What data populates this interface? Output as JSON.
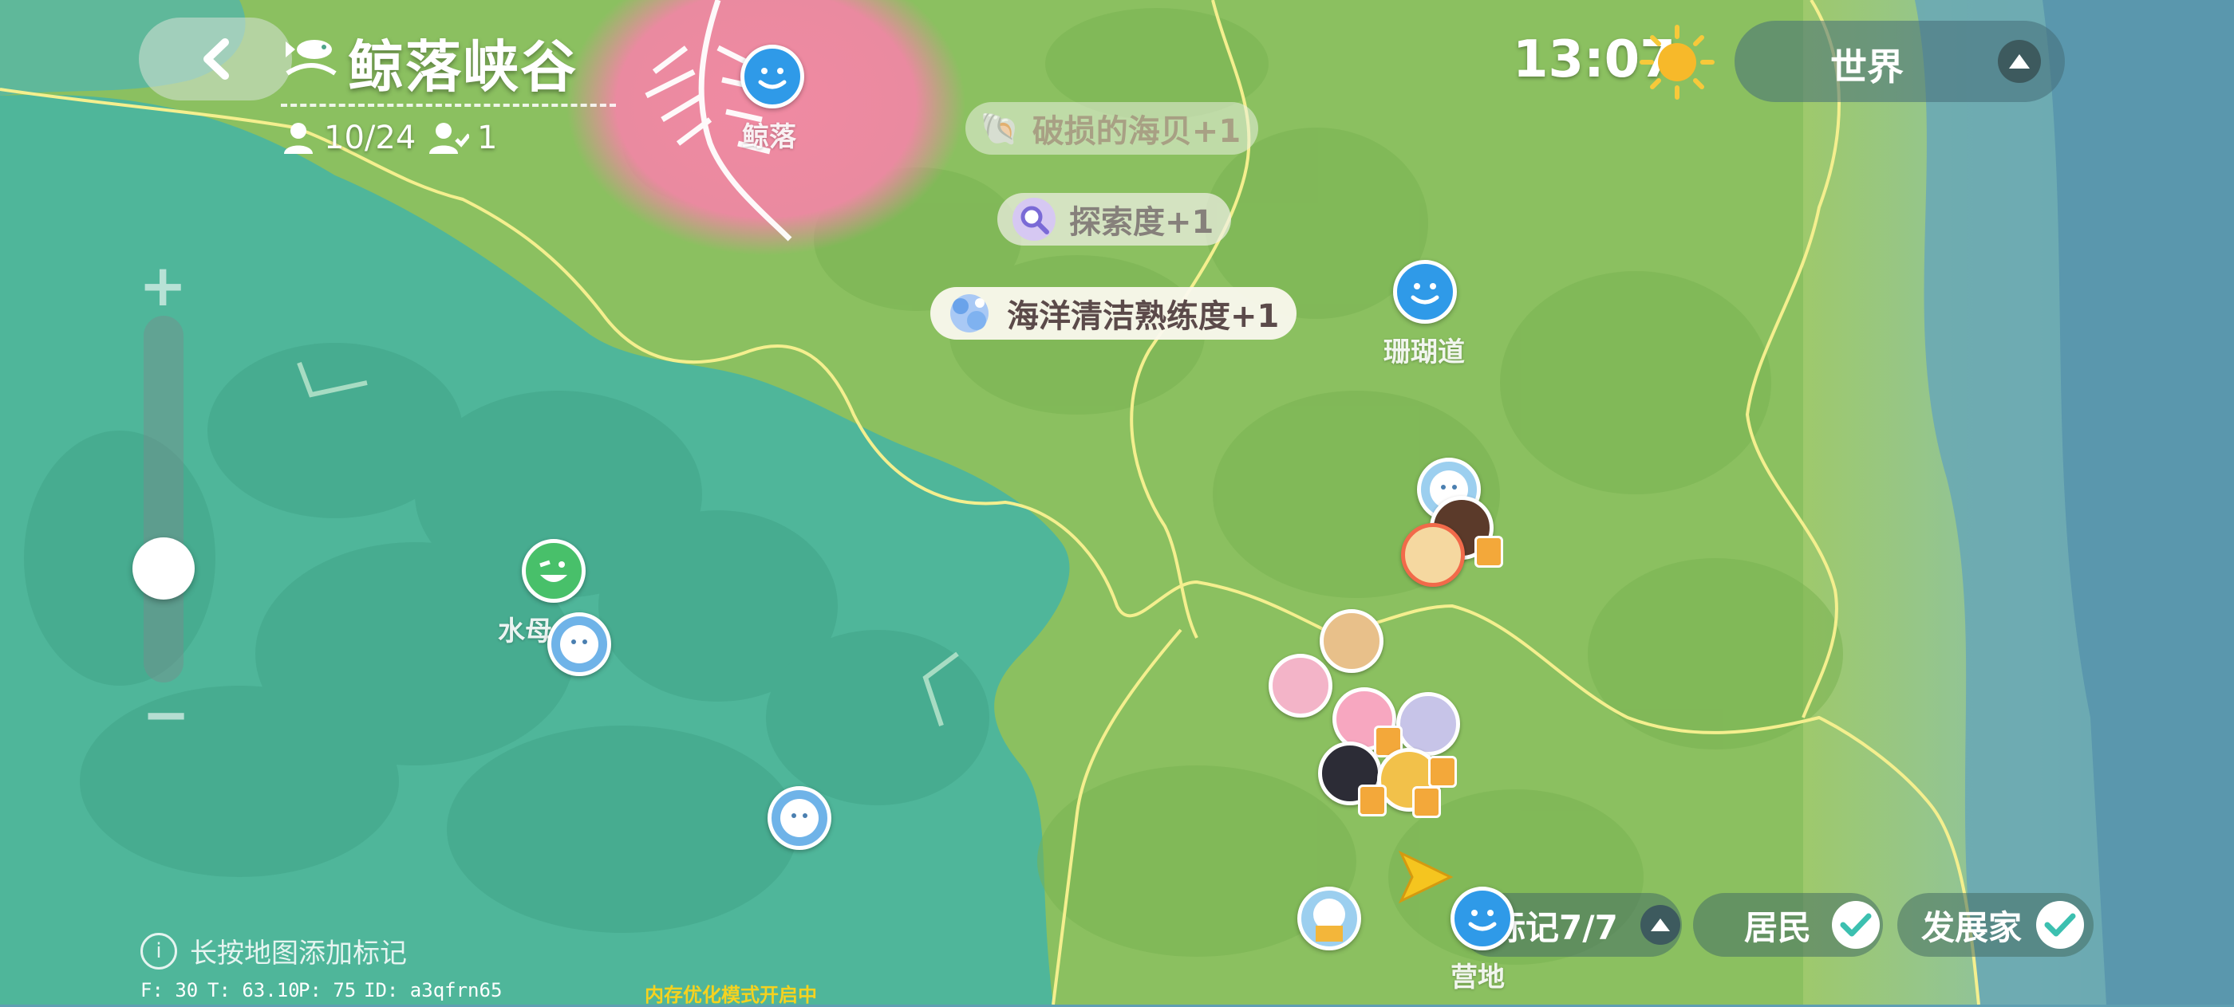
{
  "header": {
    "back_label": "back",
    "area_title": "鲸落峡谷",
    "player_count": "10/24",
    "friend_count": "1"
  },
  "time": {
    "clock": "13:07",
    "weather_icon": "sun-icon"
  },
  "world_selector": {
    "label": "世界"
  },
  "notifications": [
    {
      "text": "破损的海贝+1",
      "icon": "shell-icon"
    },
    {
      "text": "探索度+1",
      "icon": "magnifier-icon"
    },
    {
      "text": "海洋清洁熟练度+1",
      "icon": "cleaning-icon"
    }
  ],
  "map_labels": {
    "whale_fall": "鲸落",
    "coral_path": "珊瑚道",
    "jellyfish": "水母",
    "camp": "营地"
  },
  "hint": {
    "text": "长按地图添加标记"
  },
  "filters": {
    "markers": "标记7/7",
    "residents": "居民",
    "developers": "发展家"
  },
  "zoom": {
    "plus": "+",
    "minus": "−",
    "level": 0.2
  },
  "debug": {
    "f": "F: 30",
    "t": "T: 63.10",
    "p": "P: 75",
    "id": "ID: a3qfrn65",
    "memory": "内存优化模式开启中"
  },
  "colors": {
    "ocean": "#5e9fb2",
    "teal_region": "#4fb69a",
    "green_region": "#8cc161",
    "pink_region": "#e98aa0",
    "border_line": "#f4ef8e",
    "poi_blue": "#2f9ae8",
    "poi_green": "#48c06a",
    "accent_check": "#3cc0b0"
  }
}
